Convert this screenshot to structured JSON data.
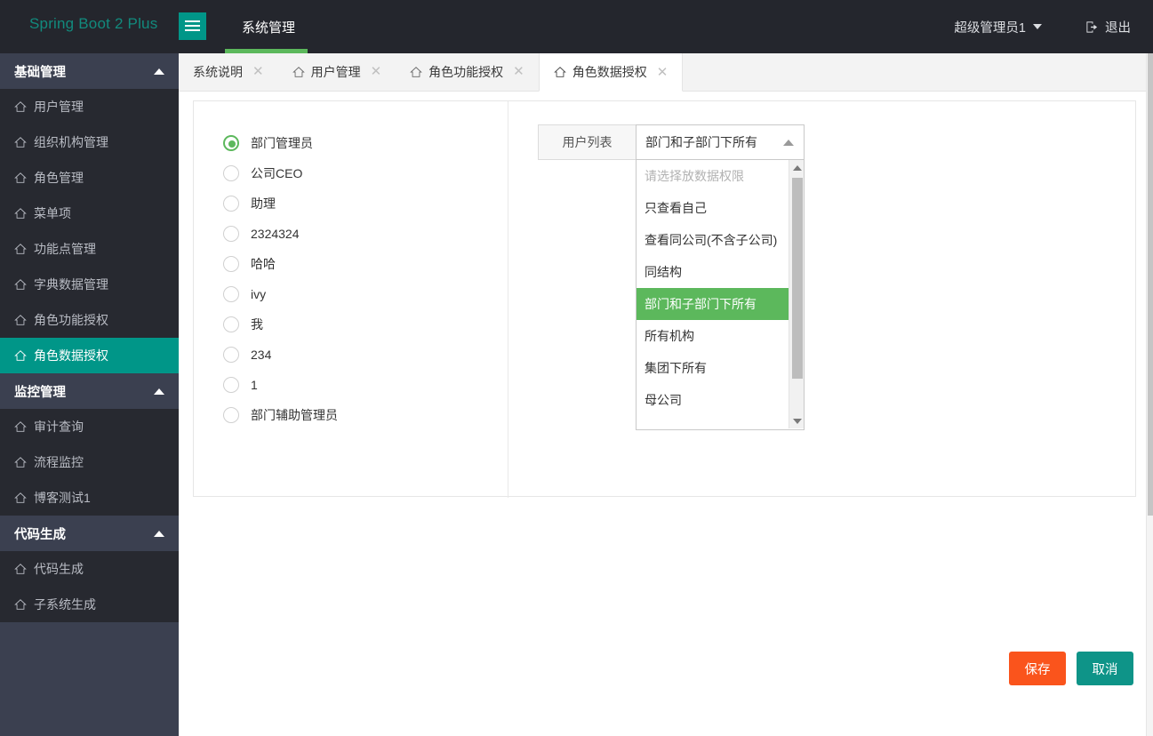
{
  "header": {
    "logo": "Spring Boot 2 Plus",
    "menu_toggle_icon": "hamburger-icon",
    "nav_title": "系统管理",
    "accent_color": "#5cb85c",
    "user_name": "超级管理员1",
    "logout_label": "退出",
    "logout_icon": "logout-icon",
    "background_color": "#24262d"
  },
  "sidebar": {
    "background_color": "#3b4050",
    "active_color": "#009688",
    "groups": [
      {
        "label": "基础管理",
        "collapse_icon": "chevron-up-icon",
        "items": [
          {
            "label": "用户管理",
            "icon": "home-icon",
            "active": false
          },
          {
            "label": "组织机构管理",
            "icon": "home-icon",
            "active": false
          },
          {
            "label": "角色管理",
            "icon": "home-icon",
            "active": false
          },
          {
            "label": "菜单项",
            "icon": "home-icon",
            "active": false
          },
          {
            "label": "功能点管理",
            "icon": "home-icon",
            "active": false
          },
          {
            "label": "字典数据管理",
            "icon": "home-icon",
            "active": false
          },
          {
            "label": "角色功能授权",
            "icon": "home-icon",
            "active": false
          },
          {
            "label": "角色数据授权",
            "icon": "home-icon",
            "active": true
          }
        ]
      },
      {
        "label": "监控管理",
        "collapse_icon": "chevron-up-icon",
        "items": [
          {
            "label": "审计查询",
            "icon": "home-icon",
            "active": false
          },
          {
            "label": "流程监控",
            "icon": "home-icon",
            "active": false
          },
          {
            "label": "博客测试1",
            "icon": "home-icon",
            "active": false
          }
        ]
      },
      {
        "label": "代码生成",
        "collapse_icon": "chevron-up-icon",
        "items": [
          {
            "label": "代码生成",
            "icon": "home-icon",
            "active": false
          },
          {
            "label": "子系统生成",
            "icon": "home-icon",
            "active": false
          }
        ]
      }
    ]
  },
  "tabs": [
    {
      "label": "系统说明",
      "icon": null,
      "close_icon": "close-icon",
      "active": false
    },
    {
      "label": "用户管理",
      "icon": "home-icon",
      "close_icon": "close-icon",
      "active": false
    },
    {
      "label": "角色功能授权",
      "icon": "home-icon",
      "close_icon": "close-icon",
      "active": false
    },
    {
      "label": "角色数据授权",
      "icon": "home-icon",
      "close_icon": "close-icon",
      "active": true
    }
  ],
  "main": {
    "roles": [
      {
        "label": "部门管理员",
        "selected": true
      },
      {
        "label": "公司CEO",
        "selected": false
      },
      {
        "label": "助理",
        "selected": false
      },
      {
        "label": "2324324",
        "selected": false
      },
      {
        "label": "哈哈",
        "selected": false
      },
      {
        "label": "ivy",
        "selected": false
      },
      {
        "label": "我",
        "selected": false
      },
      {
        "label": "234",
        "selected": false
      },
      {
        "label": "1",
        "selected": false
      },
      {
        "label": "部门辅助管理员",
        "selected": false
      }
    ],
    "select": {
      "addon_label": "用户列表",
      "value": "部门和子部门下所有",
      "caret_icon": "chevron-up-icon",
      "open": true,
      "selected_option_color": "#5cb85c",
      "options": [
        {
          "label": "请选择放数据权限",
          "placeholder": true,
          "selected": false
        },
        {
          "label": "只查看自己",
          "placeholder": false,
          "selected": false
        },
        {
          "label": "查看同公司(不含子公司)",
          "placeholder": false,
          "selected": false
        },
        {
          "label": "同结构",
          "placeholder": false,
          "selected": false
        },
        {
          "label": "部门和子部门下所有",
          "placeholder": false,
          "selected": true
        },
        {
          "label": "所有机构",
          "placeholder": false,
          "selected": false
        },
        {
          "label": "集团下所有",
          "placeholder": false,
          "selected": false
        },
        {
          "label": "母公司",
          "placeholder": false,
          "selected": false
        }
      ],
      "scrollbar": {
        "up_icon": "scroll-up-arrow-icon",
        "down_icon": "scroll-down-arrow-icon"
      }
    }
  },
  "footer": {
    "save_label": "保存",
    "save_color": "#fa541c",
    "cancel_label": "取消",
    "cancel_color": "#0e9488"
  }
}
